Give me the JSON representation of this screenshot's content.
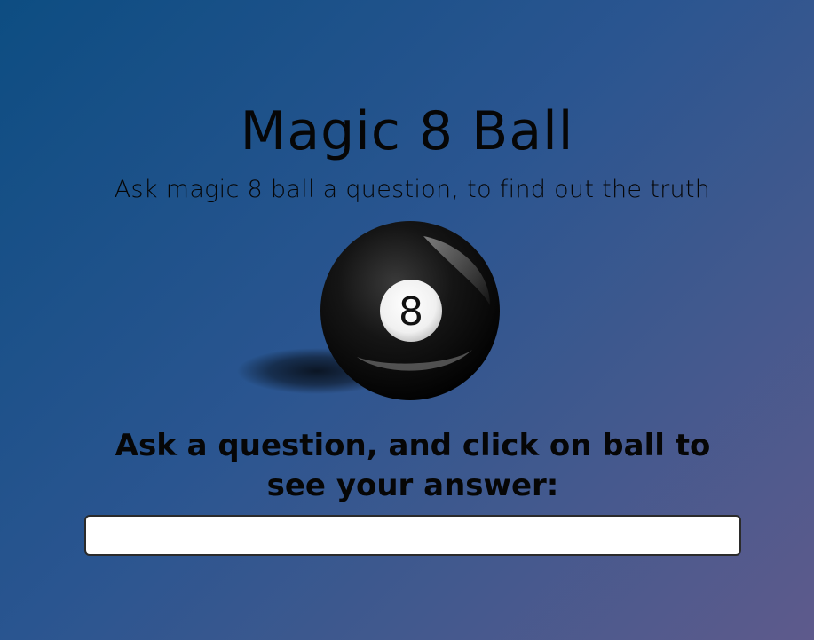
{
  "header": {
    "title": "Magic 8 Ball",
    "subtitle": "Ask magic 8 ball a question, to find out the truth"
  },
  "ball": {
    "number": "8"
  },
  "prompt": {
    "text": "Ask a question, and click on ball to see your answer:"
  },
  "question_input": {
    "value": "",
    "placeholder": ""
  },
  "colors": {
    "background_start": "#0d4d82",
    "background_end": "#5e5a8c",
    "text": "#060606",
    "input_border": "#2b2b2b"
  }
}
